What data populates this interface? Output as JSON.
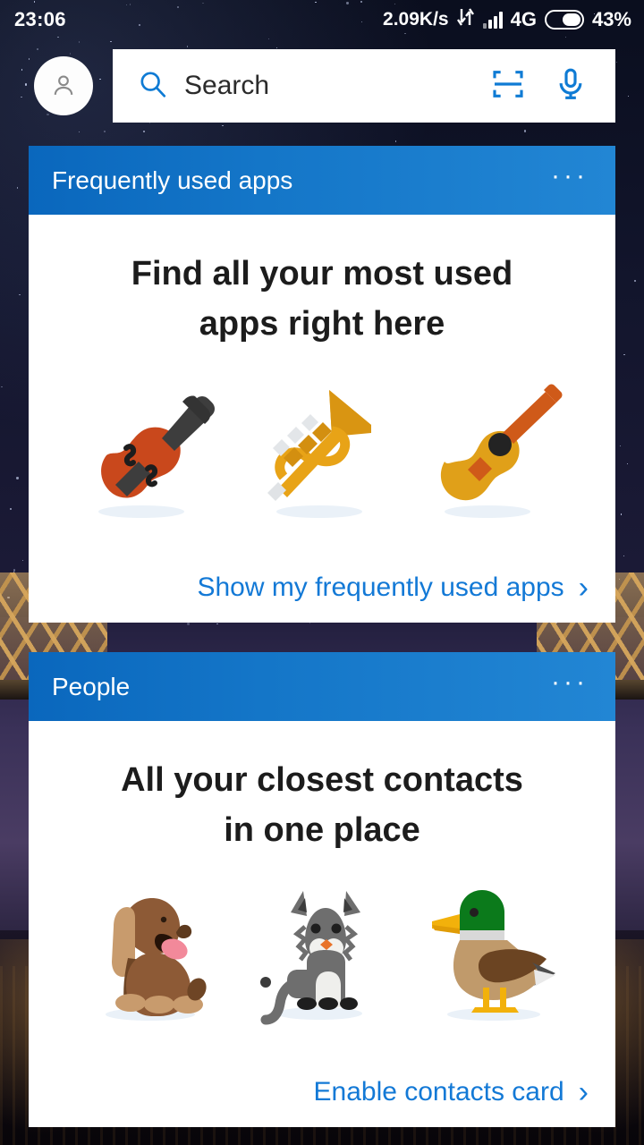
{
  "statusbar": {
    "clock": "23:06",
    "net_speed": "2.09K/s",
    "network_type": "4G",
    "battery_percent": "43%",
    "signal_bars": 4,
    "icons": [
      "data-transfer-icon",
      "signal-icon",
      "battery-icon"
    ]
  },
  "search": {
    "placeholder": "Search",
    "value": "Search",
    "avatar_icon": "person-icon",
    "search_icon": "search-icon",
    "scan_icon": "scan-icon",
    "mic_icon": "microphone-icon",
    "accent": "#0f7bd4"
  },
  "cards": [
    {
      "title": "Frequently used apps",
      "menu": "···",
      "headline_line1": "Find all your most used",
      "headline_line2": "apps right here",
      "link": "Show my frequently used apps",
      "chevron": "›",
      "illustrations": [
        "violin-illustration",
        "trumpet-illustration",
        "guitar-illustration"
      ]
    },
    {
      "title": "People",
      "menu": "···",
      "headline_line1": "All your closest contacts",
      "headline_line2": "in one place",
      "link": "Enable contacts card",
      "chevron": "›",
      "illustrations": [
        "dog-illustration",
        "cat-illustration",
        "duck-illustration"
      ]
    }
  ],
  "colors": {
    "card_header_blue_dark": "#0a67bd",
    "card_header_blue_light": "#2286d4",
    "link_blue": "#1379d6",
    "card_background": "#ffffff",
    "headline_text": "#1c1c1c"
  }
}
